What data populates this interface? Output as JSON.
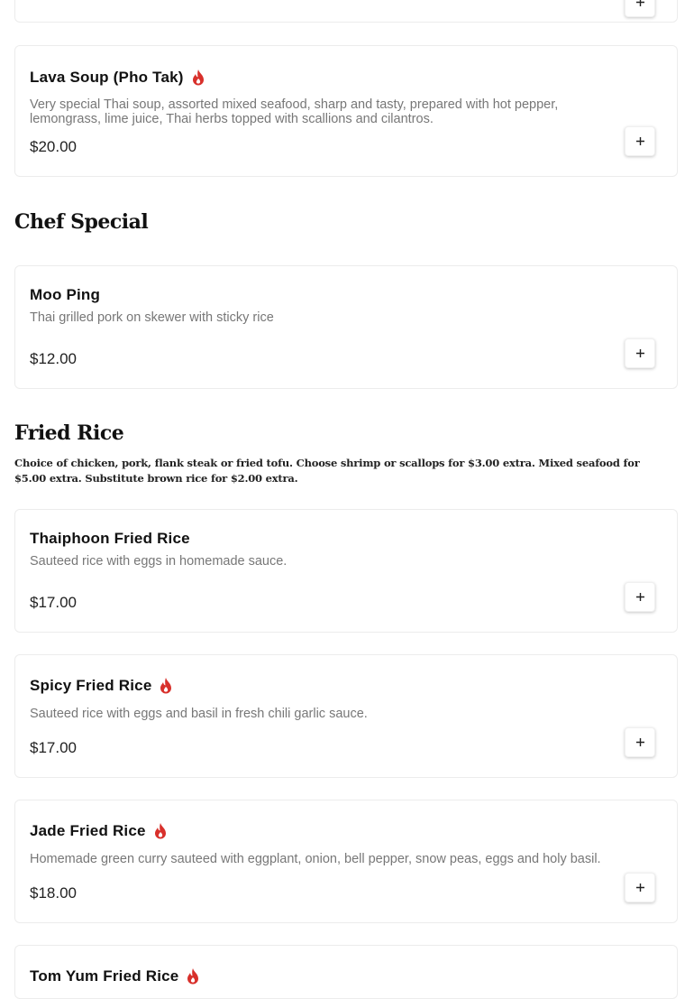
{
  "sections": {
    "chef_special": {
      "title": "Chef Special"
    },
    "fried_rice": {
      "title": "Fried Rice",
      "note": "Choice of chicken, pork, flank steak or fried tofu. Choose shrimp or scallops for $3.00 extra. Mixed seafood for $5.00 extra. Substitute brown rice for $2.00 extra."
    }
  },
  "items": [
    {
      "id": "lava-soup",
      "name": "Lava Soup (Pho Tak)",
      "spicy": true,
      "description": "Very special Thai soup, assorted mixed seafood, sharp and tasty, prepared with hot pepper, lemongrass, lime juice, Thai herbs topped with scallions and cilantros.",
      "price": "$20.00"
    },
    {
      "id": "moo-ping",
      "name": "Moo Ping",
      "spicy": false,
      "description": "Thai grilled pork on skewer with sticky rice",
      "price": "$12.00"
    },
    {
      "id": "thaiphoon-fried-rice",
      "name": "Thaiphoon Fried Rice",
      "spicy": false,
      "description": "Sauteed rice with eggs in homemade sauce.",
      "price": "$17.00"
    },
    {
      "id": "spicy-fried-rice",
      "name": "Spicy Fried Rice",
      "spicy": true,
      "description": "Sauteed rice with eggs and basil in fresh chili garlic sauce.",
      "price": "$17.00"
    },
    {
      "id": "jade-fried-rice",
      "name": "Jade Fried Rice",
      "spicy": true,
      "description": "Homemade green curry sauteed with eggplant, onion, bell pepper, snow peas, eggs and holy basil.",
      "price": "$18.00"
    },
    {
      "id": "tom-yum-fried-rice",
      "name": "Tom Yum Fried Rice",
      "spicy": true
    }
  ],
  "icons": {
    "spicy": "flame-icon",
    "add": "plus-icon"
  },
  "colors": {
    "spicy": "#d8302b",
    "card_border": "#ececec"
  }
}
